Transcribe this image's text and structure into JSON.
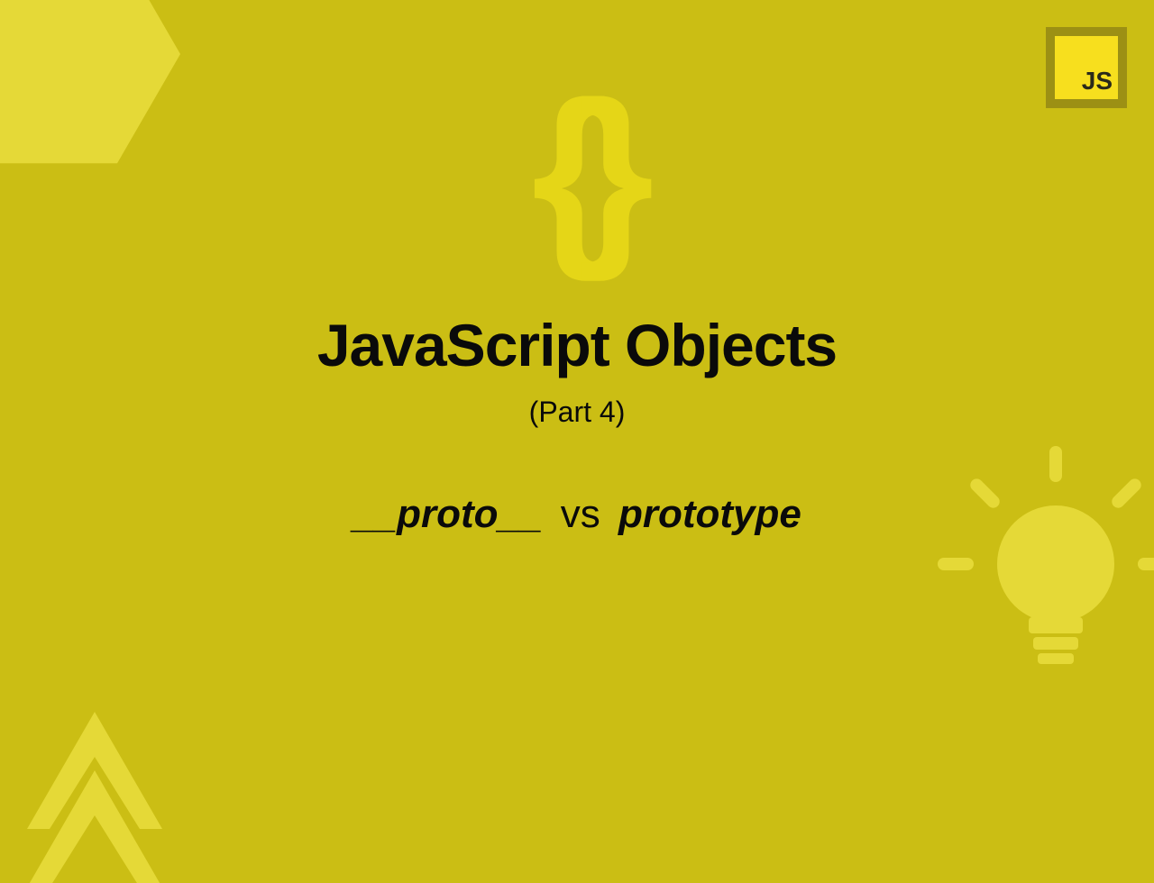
{
  "logo": {
    "text": "JS"
  },
  "braces": "{}",
  "title": "JavaScript Objects",
  "subtitle": "(Part 4)",
  "comparison": {
    "left": "__proto__",
    "middle": "vs",
    "right": "prototype"
  }
}
